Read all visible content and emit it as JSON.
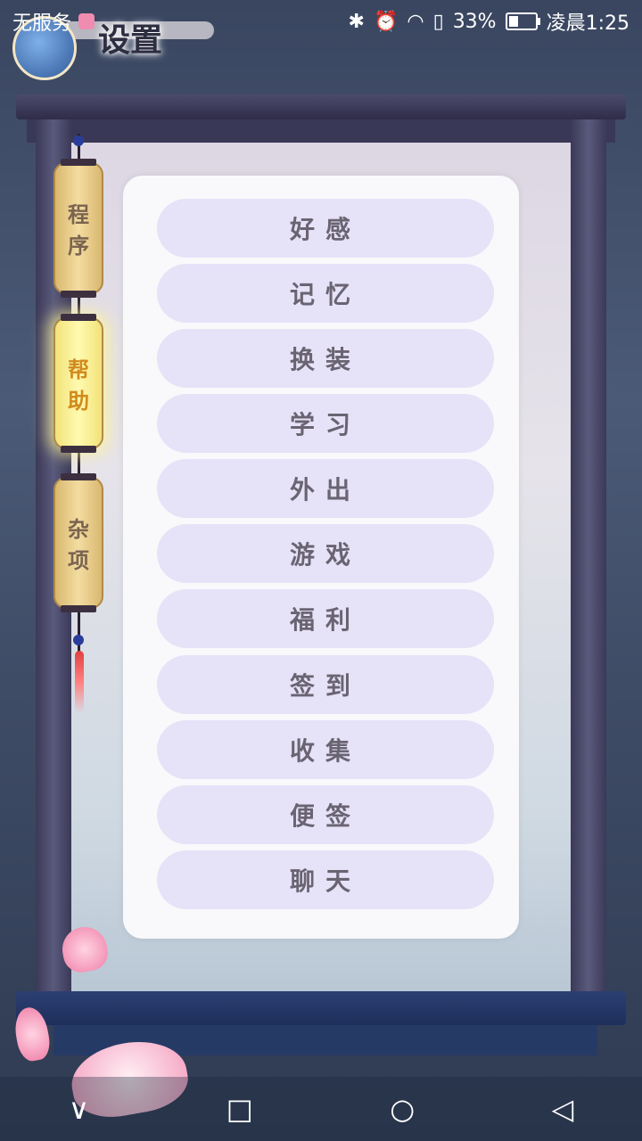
{
  "status_bar": {
    "carrier": "无服务",
    "battery": "33%",
    "battery_level": 0.33,
    "time": "凌晨1:25",
    "icons": [
      "bluetooth-icon",
      "alarm-icon",
      "wifi-icon",
      "sim-icon",
      "battery-icon"
    ]
  },
  "header": {
    "title": "设置"
  },
  "sidebar": {
    "tabs": [
      {
        "label_line1": "程",
        "label_line2": "序",
        "active": false
      },
      {
        "label_line1": "帮",
        "label_line2": "助",
        "active": true
      },
      {
        "label_line1": "杂",
        "label_line2": "项",
        "active": false
      }
    ]
  },
  "menu": {
    "items": [
      "好感",
      "记忆",
      "换装",
      "学习",
      "外出",
      "游戏",
      "福利",
      "签到",
      "收集",
      "便签",
      "聊天"
    ]
  },
  "navbar": {
    "icons": [
      "back-icon",
      "home-icon",
      "recents-icon",
      "collapse-icon"
    ],
    "glyphs": [
      "∨",
      "□",
      "○",
      "◁"
    ]
  },
  "colors": {
    "menu_item_bg": "#e6e2f8",
    "menu_text": "#6a6472",
    "active_tab_text": "#d28a1c"
  }
}
